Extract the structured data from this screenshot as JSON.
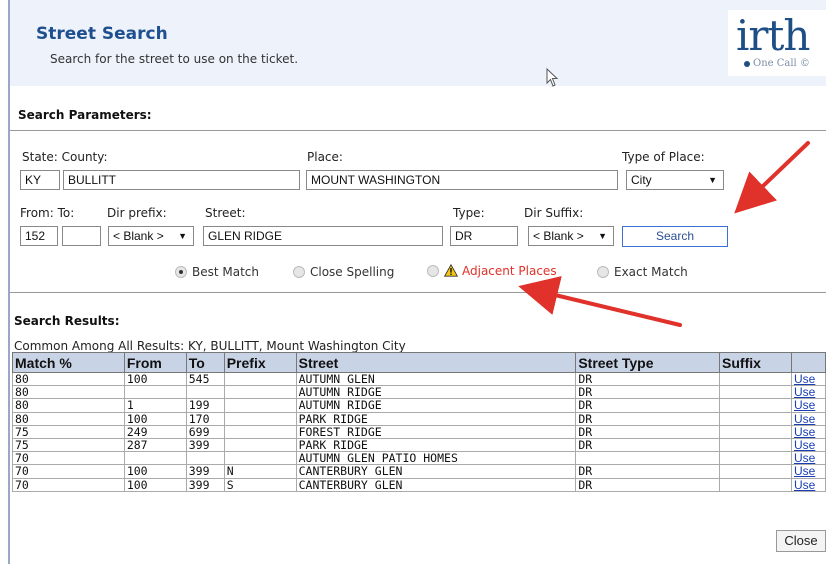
{
  "header": {
    "title": "Street Search",
    "subtitle": "Search for the street to use on the ticket.",
    "logo_text": "irth",
    "logo_sub": "One Call ©"
  },
  "params": {
    "section_title": "Search Parameters:",
    "state_county_label": "State: County:",
    "place_label": "Place:",
    "type_of_place_label": "Type of Place:",
    "state_value": "KY",
    "county_value": "BULLITT",
    "place_value": "MOUNT WASHINGTON",
    "type_of_place_value": "City",
    "from_to_label": "From: To:",
    "dir_prefix_label": "Dir prefix:",
    "street_label": "Street:",
    "type_label": "Type:",
    "dir_suffix_label": "Dir Suffix:",
    "from_value": "152",
    "to_value": "",
    "dir_prefix_value": "< Blank >",
    "street_value": "GLEN RIDGE",
    "type_value": "DR",
    "dir_suffix_value": "< Blank >",
    "search_button": "Search"
  },
  "match_options": [
    {
      "label": "Best Match",
      "selected": true
    },
    {
      "label": "Close Spelling",
      "selected": false
    },
    {
      "label": "Adjacent Places",
      "selected": false
    },
    {
      "label": "Exact Match",
      "selected": false
    }
  ],
  "results": {
    "section_title": "Search Results:",
    "common_text": "Common Among All Results: KY, BULLITT, Mount Washington City",
    "columns": [
      "Match %",
      "From",
      "To",
      "Prefix",
      "Street",
      "Street Type",
      "Suffix",
      ""
    ],
    "use_label": "Use",
    "rows": [
      [
        "80",
        "100",
        "545",
        "",
        "AUTUMN GLEN",
        "DR",
        ""
      ],
      [
        "80",
        "",
        "",
        "",
        "AUTUMN RIDGE",
        "DR",
        ""
      ],
      [
        "80",
        "1",
        "199",
        "",
        "AUTUMN RIDGE",
        "DR",
        ""
      ],
      [
        "80",
        "100",
        "170",
        "",
        "PARK RIDGE",
        "DR",
        ""
      ],
      [
        "75",
        "249",
        "699",
        "",
        "FOREST RIDGE",
        "DR",
        ""
      ],
      [
        "75",
        "287",
        "399",
        "",
        "PARK RIDGE",
        "DR",
        ""
      ],
      [
        "70",
        "",
        "",
        "",
        "AUTUMN GLEN PATIO HOMES",
        "",
        ""
      ],
      [
        "70",
        "100",
        "399",
        "N",
        "CANTERBURY GLEN",
        "DR",
        ""
      ],
      [
        "70",
        "100",
        "399",
        "S",
        "CANTERBURY GLEN",
        "DR",
        ""
      ]
    ]
  },
  "footer": {
    "close_button": "Close"
  },
  "colors": {
    "accent": "#1e4f8e",
    "header_bg": "#eef2fb",
    "table_header": "#c9d3e6",
    "arrow": "#e0312a",
    "warning_text": "#e0312a"
  }
}
